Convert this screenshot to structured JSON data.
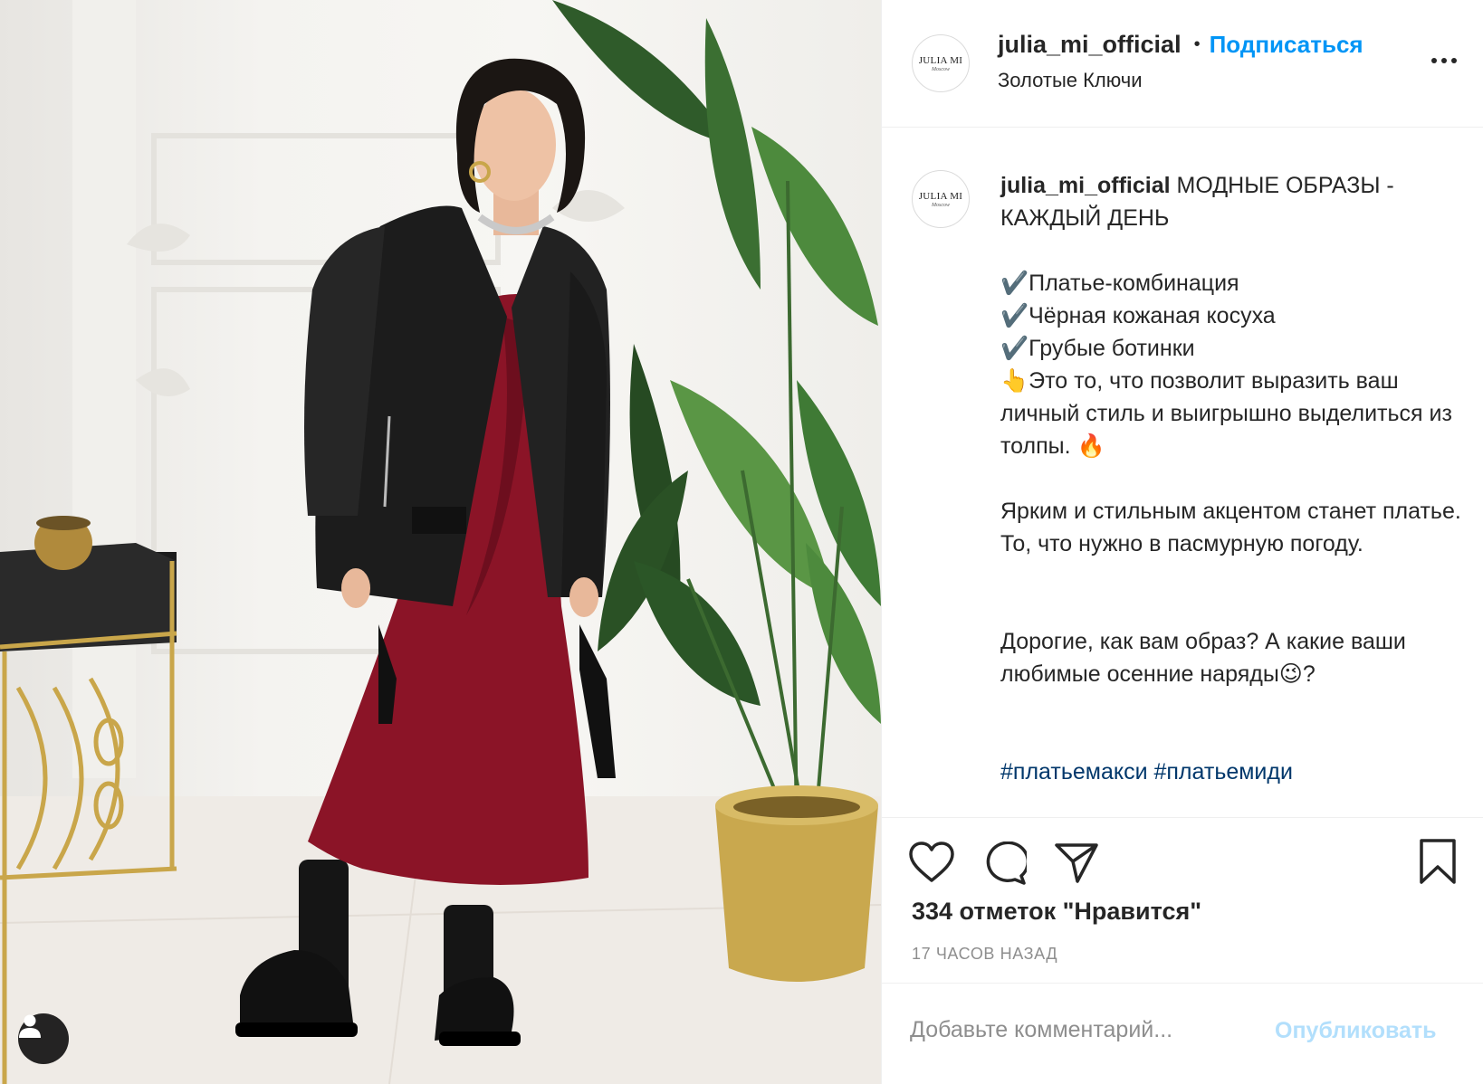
{
  "post": {
    "username": "julia_mi_official",
    "dot": "•",
    "follow_label": "Подписаться",
    "location": "Золотые Ключи",
    "avatar_logo": "JULIA MI",
    "avatar_logo_sub": "Moscow"
  },
  "caption": {
    "username": "julia_mi_official",
    "title": "МОДНЫЕ ОБРАЗЫ - КАЖДЫЙ ДЕНЬ",
    "lines": [
      "✔️Платье-комбинация",
      "✔️Чёрная кожаная косуха",
      "✔️Грубые ботинки",
      "👆Это то, что позволит выразить ваш личный стиль и выигрышно выделиться из толпы. 🔥"
    ],
    "paragraph2": "Ярким и стильным акцентом станет платье. То, что нужно в пасмурную погоду.",
    "paragraph3": "Дорогие, как вам образ? А какие ваши любимые осенние наряды😉?",
    "hashtags": "#платьемакси #платьемиди"
  },
  "actions": {
    "likes_text": "334 отметок \"Нравится\"",
    "timestamp": "17 ЧАСОВ НАЗАД"
  },
  "comment_form": {
    "placeholder": "Добавьте комментарий...",
    "publish_label": "Опубликовать"
  },
  "icons": {
    "like": "heart-icon",
    "comment": "comment-bubble-icon",
    "share": "paper-plane-icon",
    "save": "bookmark-icon",
    "more": "three-dots-icon",
    "user_tag": "user-icon"
  },
  "colors": {
    "accent": "#0095f6",
    "publish_disabled": "#b2dffc",
    "hashtag": "#00376b",
    "muted": "#8e8e8e"
  }
}
